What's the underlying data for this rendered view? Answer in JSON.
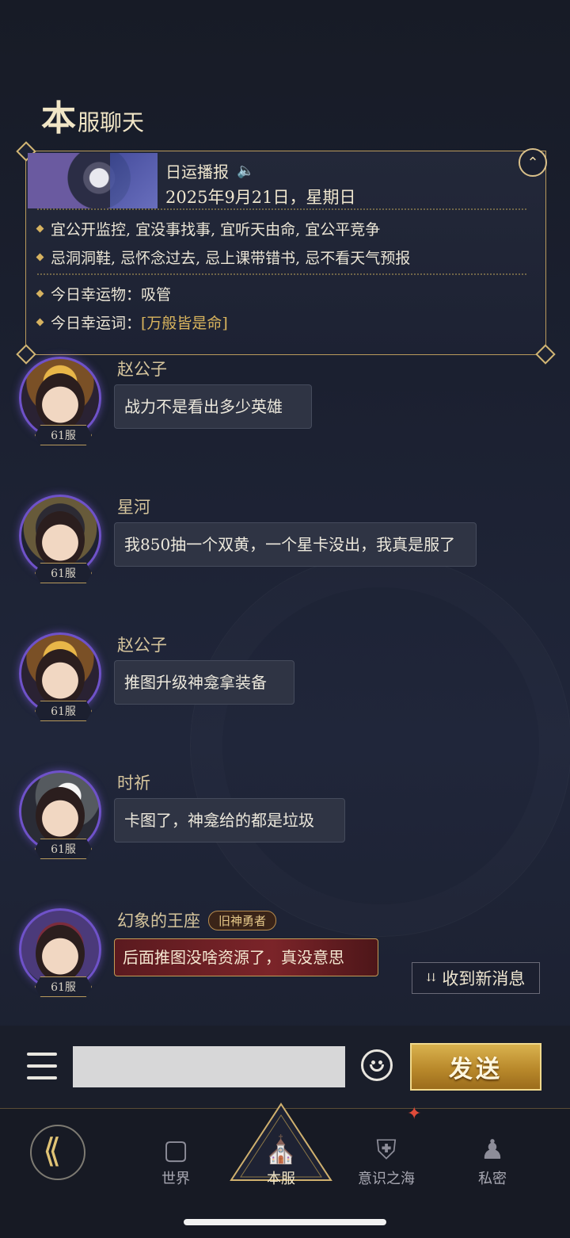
{
  "header": {
    "title_big": "本",
    "title_rest": "服聊天"
  },
  "daily": {
    "heading": "日运播报",
    "date": "2025年9月21日，星期日",
    "good": "宜公开监控, 宜没事找事, 宜听天由命, 宜公平竞争",
    "bad": "忌洞洞鞋, 忌怀念过去, 忌上课带错书, 忌不看天气预报",
    "lucky_item_label": "今日幸运物：",
    "lucky_item": "吸管",
    "lucky_word_label": "今日幸运词：",
    "lucky_word": "[万般皆是命]"
  },
  "messages": [
    {
      "name": "赵公子",
      "server": "61服",
      "text": "战力不是看出多少英雄"
    },
    {
      "name": "星河",
      "server": "61服",
      "text": "我850抽一个双黄，一个星卡没出，我真是服了"
    },
    {
      "name": "赵公子",
      "server": "61服",
      "text": "推图升级神龛拿装备"
    },
    {
      "name": "时祈",
      "server": "61服",
      "text": "卡图了，神龛给的都是垃圾"
    },
    {
      "name": "幻象的王座",
      "badge": "旧神勇者",
      "server": "61服",
      "text": "后面推图没啥资源了，真没意思"
    }
  ],
  "new_message_label": "收到新消息",
  "input": {
    "placeholder": ""
  },
  "send_label": "发送",
  "tabs": {
    "world": "世界",
    "server": "本服",
    "sea": "意识之海",
    "private": "私密"
  }
}
